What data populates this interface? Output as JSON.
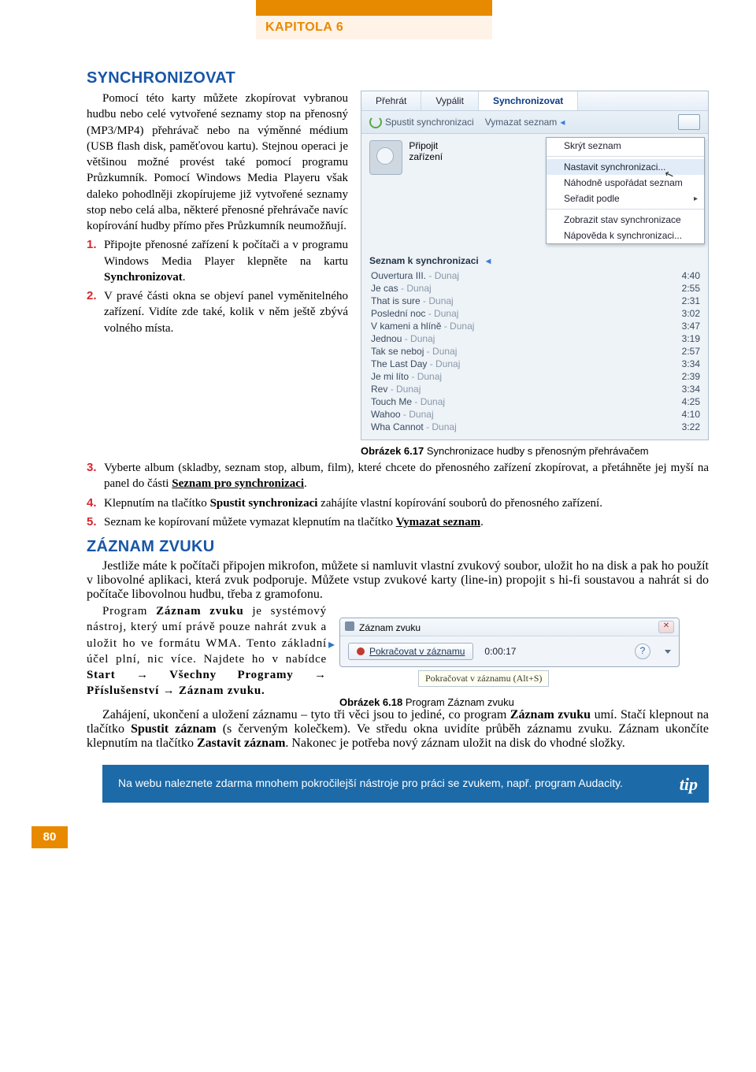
{
  "chapter": "KAPITOLA 6",
  "page_number": "80",
  "sections": {
    "sync": {
      "title": "SYNCHRONIZOVAT",
      "p1": "Pomocí této karty můžete zkopírovat vybranou hudbu nebo celé vytvořené seznamy stop na přenosný (MP3/MP4) přehrávač nebo na výměnné médium (USB flash disk, paměťovou kartu). Stejnou operaci je většinou možné provést také pomocí programu Průzkumník. Pomocí Windows Media Playeru však daleko pohodlněji zkopírujeme již vytvořené seznamy stop nebo celá alba, některé přenosné přehrávače navíc kopírování hudby přímo přes Průzkumník neumožňují.",
      "li1_a": "Připojte přenosné zařízení k počítači a v programu Windows Media Player klepněte na kartu ",
      "li1_b": "Synchronizovat",
      "li2_a": "V pravé části okna se objeví panel vyměnitelného zařízení. Vidíte zde také, kolik v něm ještě zbývá volného místa.",
      "li3_a": "Vyberte album (skladby, seznam stop, album, film), které chcete do přenosného zařízení zkopírovat, a přetáhněte jej myší na panel do části ",
      "li3_b": "Seznam pro synchronizaci",
      "li4_a": "Klepnutím na tlačítko ",
      "li4_b": "Spustit synchronizaci",
      "li4_c": " zahájíte vlastní kopírování souborů do přenosného zařízení.",
      "li5_a": "Seznam ke kopírovaní můžete vymazat klepnutím na tlačítko ",
      "li5_b": "Vymazat seznam"
    },
    "record": {
      "title": "ZÁZNAM ZVUKU",
      "p1": "Jestliže máte k počítači připojen mikrofon, můžete si namluvit vlastní zvukový soubor, uložit ho na disk a pak ho použít v libovolné aplikaci, která zvuk podporuje. Můžete vstup zvukové karty (line-in) propojit s hi-fi soustavou a nahrát si do počítače libovolnou hudbu, třeba z gramofonu.",
      "p2_a": "Program ",
      "p2_b": "Záznam zvuku",
      "p2_c": " je systémový nástroj, který umí právě pouze nahrát zvuk a uložit ho ve formátu WMA. Tento základní účel plní, nic více. Najdete ho v nabídce ",
      "p2_path": "Start → Všechny Programy → Příslušenství → Záznam zvuku.",
      "p3_a": "Zahájení, ukončení a uložení záznamu – tyto tři věci jsou to jediné, co program ",
      "p3_b": "Záznam zvuku",
      "p3_c": " umí. Stačí klepnout na tlačítko ",
      "p3_d": "Spustit záznam",
      "p3_e": " (s červeným kolečkem). Ve středu okna uvidíte průběh záznamu zvuku. Záznam ukončíte klepnutím na tlačítko ",
      "p3_f": "Zastavit záznam",
      "p3_g": ". Nakonec je potřeba nový záznam uložit na disk do vhodné složky."
    }
  },
  "figures": {
    "f617": {
      "caption_b": "Obrázek 6.17",
      "caption_t": " Synchronizace hudby s přenosným přehrávačem",
      "tabs": {
        "play": "Přehrát",
        "burn": "Vypálit",
        "sync": "Synchronizovat"
      },
      "toolbar": {
        "start": "Spustit synchronizaci",
        "clear": "Vymazat seznam"
      },
      "attach": "Připojit zařízení",
      "menu": {
        "hide": "Skrýt seznam",
        "settings": "Nastavit synchronizaci...",
        "shuffle": "Náhodně uspořádat seznam",
        "sort": "Seřadit podle",
        "status": "Zobrazit stav synchronizace",
        "help": "Nápověda k synchronizaci..."
      },
      "list_header": "Seznam k synchronizaci",
      "tracks": [
        {
          "n": "Ouvertura III.",
          "a": "Dunaj",
          "t": "4:40"
        },
        {
          "n": "Je cas",
          "a": "Dunaj",
          "t": "2:55"
        },
        {
          "n": "That is sure",
          "a": "Dunaj",
          "t": "2:31"
        },
        {
          "n": "Poslední noc",
          "a": "Dunaj",
          "t": "3:02"
        },
        {
          "n": "V kameni a hlíně",
          "a": "Dunaj",
          "t": "3:47"
        },
        {
          "n": "Jednou",
          "a": "Dunaj",
          "t": "3:19"
        },
        {
          "n": "Tak se neboj",
          "a": "Dunaj",
          "t": "2:57"
        },
        {
          "n": "The Last Day",
          "a": "Dunaj",
          "t": "3:34"
        },
        {
          "n": "Je mi líto",
          "a": "Dunaj",
          "t": "2:39"
        },
        {
          "n": "Rev",
          "a": "Dunaj",
          "t": "3:34"
        },
        {
          "n": "Touch Me",
          "a": "Dunaj",
          "t": "4:25"
        },
        {
          "n": "Wahoo",
          "a": "Dunaj",
          "t": "4:10"
        },
        {
          "n": "Wha Cannot",
          "a": "Dunaj",
          "t": "3:22"
        }
      ]
    },
    "f618": {
      "caption_b": "Obrázek 6.18",
      "caption_t": " Program Záznam zvuku",
      "title": "Záznam zvuku",
      "button": "Pokračovat v záznamu",
      "time": "0:00:17",
      "tooltip": "Pokračovat v záznamu (Alt+S)"
    }
  },
  "tip": {
    "label": "tip",
    "text": "Na webu naleznete zdarma mnohem pokročilejší nástroje pro práci se zvukem, např. program Audacity."
  }
}
